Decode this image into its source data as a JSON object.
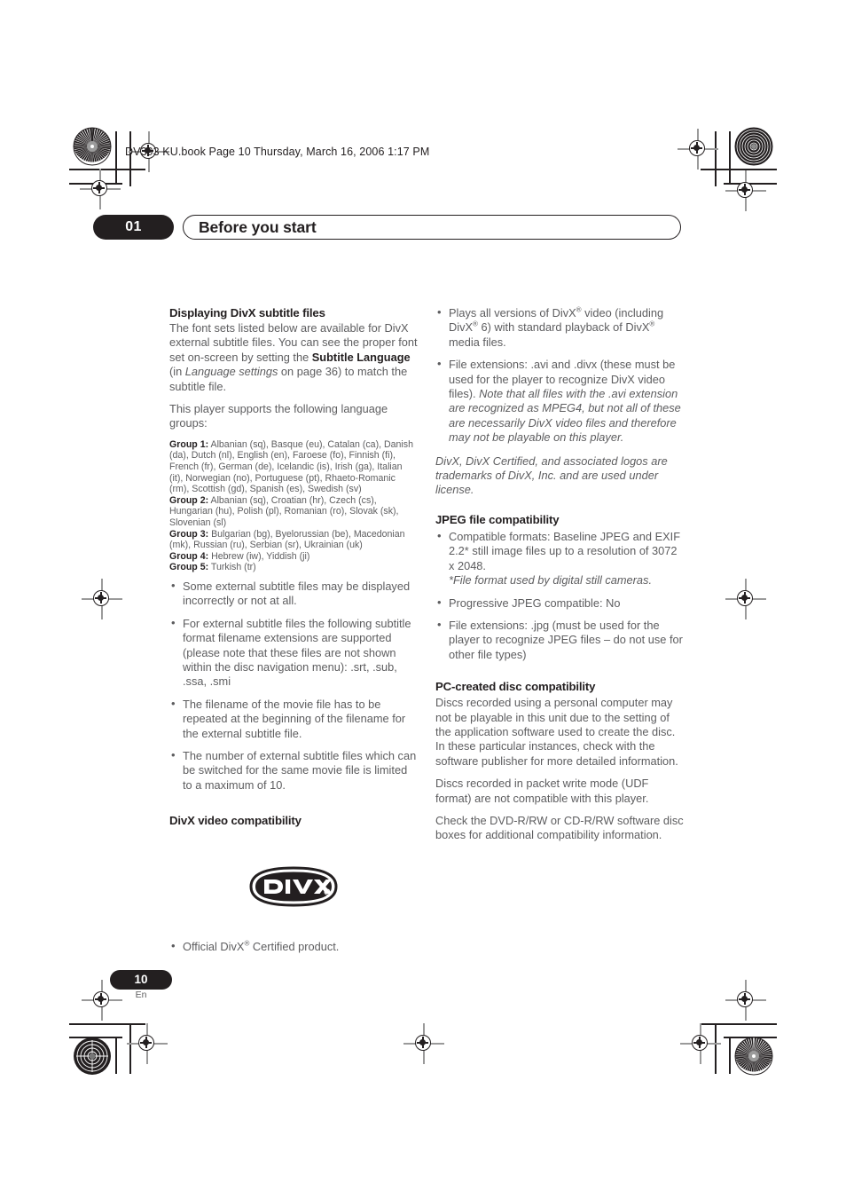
{
  "document": {
    "running_header": "DV393 KU.book  Page 10  Thursday, March 16, 2006  1:17 PM",
    "chapter_number": "01",
    "chapter_title": "Before you start",
    "page_number": "10",
    "page_language": "En",
    "ink_black": "#231f20",
    "body_gray": "#5d5d5f"
  },
  "left_column": {
    "section1": {
      "heading": "Displaying DivX subtitle files",
      "para1_a": "The font sets listed below are available for DivX external subtitle files. You can see the proper font set on-screen by setting the ",
      "para1_bold1": "Subtitle Language",
      "para1_b": " (in ",
      "para1_italic": "Language settings",
      "para1_c": " on page 36) to match the subtitle file.",
      "para2": "This player supports the following language groups:",
      "groups": [
        {
          "label": "Group 1:",
          "languages": "Albanian (sq), Basque (eu), Catalan (ca), Danish (da), Dutch (nl), English (en), Faroese (fo), Finnish (fi), French (fr), German (de), Icelandic (is), Irish (ga), Italian (it), Norwegian (no), Portuguese (pt), Rhaeto-Romanic (rm), Scottish (gd), Spanish (es), Swedish (sv)"
        },
        {
          "label": "Group 2:",
          "languages": "Albanian (sq), Croatian (hr), Czech (cs), Hungarian (hu), Polish (pl), Romanian (ro), Slovak (sk), Slovenian (sl)"
        },
        {
          "label": "Group 3:",
          "languages": "Bulgarian (bg), Byelorussian (be), Macedonian (mk), Russian (ru), Serbian (sr), Ukrainian (uk)"
        },
        {
          "label": "Group 4:",
          "languages": "Hebrew (iw), Yiddish (ji)"
        },
        {
          "label": "Group 5:",
          "languages": "Turkish (tr)"
        }
      ],
      "bullets": [
        "Some external subtitle files may be displayed incorrectly or not at all.",
        "For external subtitle files the following subtitle format filename extensions are supported (please note that these files are not shown within the disc navigation menu): .srt, .sub, .ssa, .smi",
        "The filename of the movie file has to be repeated at the beginning of the filename for the external subtitle file.",
        "The number of external subtitle files which can be switched for the same movie file is limited to a maximum of 10."
      ]
    },
    "section2": {
      "heading": "DivX video compatibility",
      "logo_text": "DIVX",
      "logo_reg": "®",
      "bullet_a": "Official DivX",
      "bullet_reg": "®",
      "bullet_b": " Certified product."
    }
  },
  "right_column": {
    "divx_bullets": {
      "b1_a": "Plays all versions of DivX",
      "b1_r1": "®",
      "b1_b": " video (including DivX",
      "b1_r2": "®",
      "b1_c": " 6) with standard playback of DivX",
      "b1_r3": "®",
      "b1_d": " media files.",
      "b2_a": "File extensions: .avi and .divx (these must be used for the player to recognize DivX video files). ",
      "b2_italic": "Note that all files with the .avi extension are recognized as MPEG4, but not all of these are necessarily DivX video files and therefore may not be playable on this player."
    },
    "trademark_note": "DivX, DivX Certified, and associated logos are trademarks of DivX, Inc. and are used under license.",
    "section_jpeg": {
      "heading": "JPEG file compatibility",
      "b1_main": "Compatible formats: Baseline JPEG and EXIF 2.2* still image files up to a resolution of 3072 x 2048.",
      "b1_note": "*File format used by digital still cameras.",
      "b2": "Progressive JPEG compatible: No",
      "b3": "File extensions: .jpg (must be used for the player to recognize JPEG files – do not use for other file types)"
    },
    "section_pc": {
      "heading": "PC-created disc compatibility",
      "para1": "Discs recorded using a personal computer may not be playable in this unit due to the setting of the application software used to create the disc. In these particular instances, check with the software publisher for more detailed information.",
      "para2": "Discs recorded in packet write mode (UDF format) are not compatible with this player.",
      "para3": "Check the DVD-R/RW or CD-R/RW software disc boxes for additional compatibility information."
    }
  }
}
